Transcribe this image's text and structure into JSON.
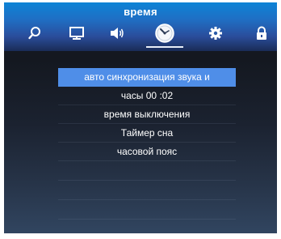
{
  "header": {
    "title": "время",
    "tabs": [
      {
        "icon": "search-icon",
        "name": "tab-search"
      },
      {
        "icon": "monitor-icon",
        "name": "tab-picture"
      },
      {
        "icon": "speaker-icon",
        "name": "tab-sound"
      },
      {
        "icon": "clock-icon",
        "name": "tab-time",
        "active": true
      },
      {
        "icon": "gear-icon",
        "name": "tab-settings"
      },
      {
        "icon": "lock-icon",
        "name": "tab-lock"
      }
    ]
  },
  "menu": {
    "selected_index": 0,
    "items": [
      {
        "label": "авто синхронизация звука и"
      },
      {
        "label": "часы 00 :02"
      },
      {
        "label": "время выключения"
      },
      {
        "label": "Таймер сна"
      },
      {
        "label": "часовой пояс"
      }
    ],
    "empty_rows": 3
  },
  "colors": {
    "accent": "#4f8ee8",
    "header_top": "#0d84d6",
    "header_bottom": "#1a2c57",
    "background": "#161a23"
  }
}
